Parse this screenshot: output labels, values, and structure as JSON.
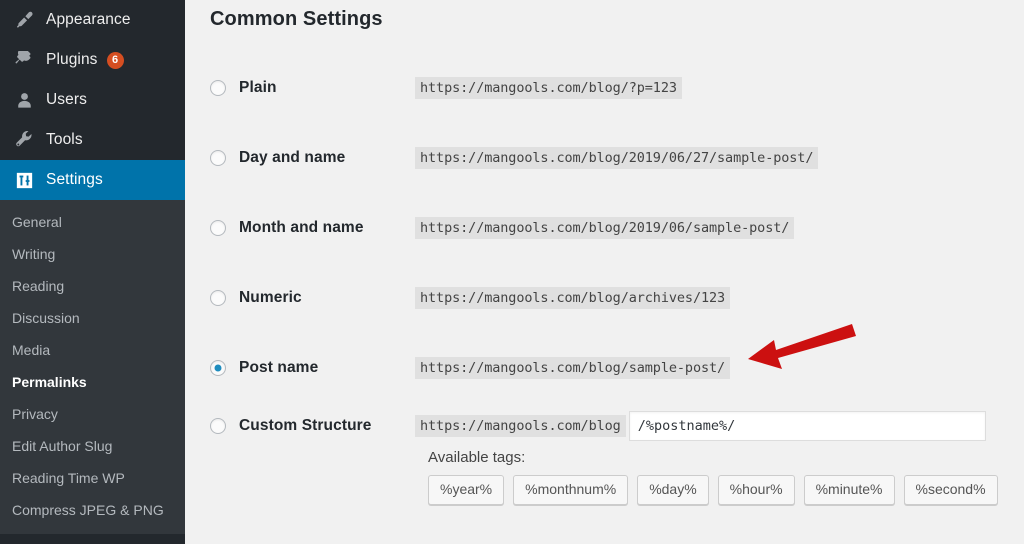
{
  "sidebar": {
    "menu": [
      {
        "label": "Appearance",
        "icon": "paintbrush-icon",
        "badge": null,
        "current": false
      },
      {
        "label": "Plugins",
        "icon": "plug-icon",
        "badge": "6",
        "current": false
      },
      {
        "label": "Users",
        "icon": "user-icon",
        "badge": null,
        "current": false
      },
      {
        "label": "Tools",
        "icon": "wrench-icon",
        "badge": null,
        "current": false
      },
      {
        "label": "Settings",
        "icon": "sliders-icon",
        "badge": null,
        "current": true
      }
    ],
    "submenu": [
      {
        "label": "General",
        "current": false
      },
      {
        "label": "Writing",
        "current": false
      },
      {
        "label": "Reading",
        "current": false
      },
      {
        "label": "Discussion",
        "current": false
      },
      {
        "label": "Media",
        "current": false
      },
      {
        "label": "Permalinks",
        "current": true
      },
      {
        "label": "Privacy",
        "current": false
      },
      {
        "label": "Edit Author Slug",
        "current": false
      },
      {
        "label": "Reading Time WP",
        "current": false
      },
      {
        "label": "Compress JPEG & PNG",
        "current": false
      }
    ]
  },
  "main": {
    "title": "Common Settings",
    "options": [
      {
        "label": "Plain",
        "example": "https://mangools.com/blog/?p=123",
        "selected": false
      },
      {
        "label": "Day and name",
        "example": "https://mangools.com/blog/2019/06/27/sample-post/",
        "selected": false
      },
      {
        "label": "Month and name",
        "example": "https://mangools.com/blog/2019/06/sample-post/",
        "selected": false
      },
      {
        "label": "Numeric",
        "example": "https://mangools.com/blog/archives/123",
        "selected": false
      },
      {
        "label": "Post name",
        "example": "https://mangools.com/blog/sample-post/",
        "selected": true
      }
    ],
    "custom": {
      "label": "Custom Structure",
      "prefix": "https://mangools.com/blog",
      "value": "/%postname%/",
      "placeholder": "/%postname%/"
    },
    "available_tags_label": "Available tags:",
    "tags": [
      "%year%",
      "%monthnum%",
      "%day%",
      "%hour%",
      "%minute%",
      "%second%"
    ]
  },
  "annotation": {
    "arrow_color": "#cc1010",
    "points_to": "Post name permalink example"
  },
  "colors": {
    "sidebar_bg": "#23282d",
    "submenu_bg": "#32373c",
    "accent_blue": "#0073aa",
    "radio_blue": "#1e8cbe",
    "badge_orange": "#d54e21",
    "content_bg": "#f1f1f1",
    "code_bg": "#e0e0e0"
  }
}
